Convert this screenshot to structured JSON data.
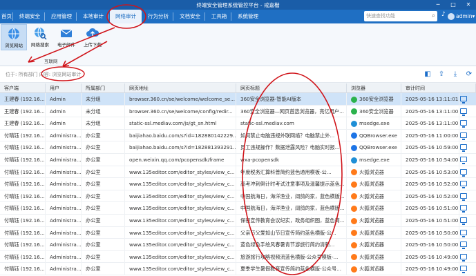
{
  "window": {
    "title": "终端安全管理系统管控平台 - 戒嘉楷",
    "min": "─",
    "max": "□",
    "close": "✕"
  },
  "menu": {
    "items": [
      {
        "label": "首页"
      },
      {
        "label": "终端安全"
      },
      {
        "label": "应用管理"
      },
      {
        "label": "本地审计"
      },
      {
        "label": "网络审计"
      },
      {
        "label": "行为分析"
      },
      {
        "label": "文档安全"
      },
      {
        "label": "工具箱"
      },
      {
        "label": "系统管理"
      }
    ],
    "active": "网络审计"
  },
  "search": {
    "placeholder": "快速查找功能"
  },
  "user": {
    "name": "admin",
    "caret": "▾"
  },
  "toolbar": {
    "tools": [
      {
        "label": "浏览网站",
        "icon": "globe-browse-icon"
      },
      {
        "label": "网络搜索",
        "icon": "globe-search-icon"
      },
      {
        "label": "电子邮件",
        "icon": "email-icon"
      },
      {
        "label": "上传下载",
        "icon": "cloud-upload-icon"
      }
    ],
    "group_label": "互联网"
  },
  "breadcrumb": {
    "text": "位于: 所有部门 内容: 浏览网站审计"
  },
  "table": {
    "columns": [
      "客户端",
      "用户",
      "所属部门",
      "网页地址",
      "网页标题",
      "浏览器",
      "审计时间"
    ],
    "rows": [
      [
        "王建春 (192.16...",
        "Admin",
        "未分组",
        "browser.360.cn/se/welcome/welcome_se...",
        "360安全浏览器-智能AI版本",
        "360安全浏览器",
        "2025-05-16 13:11:01"
      ],
      [
        "王建春 (192.16...",
        "Admin",
        "未分组",
        "browser.360.cn/se/welcome/config/redir...",
        "360安全浏览器—网页首选浏览器，亮亿用户...",
        "360安全浏览器",
        "2025-05-16 13:11:00"
      ],
      [
        "王建春 (192.16...",
        "Admin",
        "未分组",
        "static-ssl.mediav.com/js/gt_sn.html",
        "static-ssl.mediav.com",
        "msedge.exe",
        "2025-05-16 13:11:00"
      ],
      [
        "付晴钰 (192.16...",
        "Administra...",
        "办公室",
        "baijiahao.baidu.com/s?id=182880142229...",
        "如何禁止电脑违规外联网络？电脑禁止外...",
        "QQBrowser.exe",
        "2025-05-16 11:00:00"
      ],
      [
        "付晴钰 (192.16...",
        "Administra...",
        "办公室",
        "baijiahao.baidu.com/s?id=182881393291...",
        "员工违规操作？数据泄露风险？电脑实时报...",
        "QQBrowser.exe",
        "2025-05-16 10:59:00"
      ],
      [
        "付晴钰 (192.16...",
        "Administra...",
        "办公室",
        "open.weixin.qq.com/pcopensdk/frame",
        "wxa-pcopensdk",
        "msedge.exe",
        "2025-05-16 10:54:00"
      ],
      [
        "付晴钰 (192.16...",
        "Administra...",
        "办公室",
        "www.135editor.com/editor_styles/view_c...",
        "年度税务汇算科普简约蓝色通用模板-公...",
        "火狐浏览器",
        "2025-05-16 10:53:00"
      ],
      [
        "付晴钰 (192.16...",
        "Administra...",
        "办公室",
        "www.135editor.com/editor_styles/view_c...",
        "高考冲刺倒计时考试注意事项及温馨提示蓝色...",
        "火狐浏览器",
        "2025-05-16 10:52:00"
      ],
      [
        "付晴钰 (192.16...",
        "Administra...",
        "办公室",
        "www.135editor.com/editor_styles/view_c...",
        "中国航海日，海洋渔业，阔鸽的家，蓝色横版...",
        "火狐浏览器",
        "2025-05-16 10:52:00"
      ],
      [
        "付晴钰 (192.16...",
        "Administra...",
        "办公室",
        "www.135editor.com/editor_styles/view_c...",
        "中国航海日，海洋渔业，阔鸽的家，蓝色横版...",
        "火狐浏览器",
        "2025-05-16 10:51:00"
      ],
      [
        "付晴钰 (192.16...",
        "Administra...",
        "办公室",
        "www.135editor.com/editor_styles/view_c...",
        "保密宣传教育会议纪实，政务组织图，蓝色简...",
        "火狐浏览器",
        "2025-05-16 10:51:00"
      ],
      [
        "付晴钰 (192.16...",
        "Administra...",
        "办公室",
        "www.135editor.com/editor_styles/view_c...",
        "父亲节父爱如山节日宣传简约蓝色横版-公...",
        "火狐浏览器",
        "2025-05-16 10:50:00"
      ],
      [
        "付晴钰 (192.16...",
        "Administra...",
        "办公室",
        "www.135editor.com/editor_styles/view_c...",
        "蓝色绿色手绘风春暑青节游旅行简约清新...",
        "火狐浏览器",
        "2025-05-16 10:50:00"
      ],
      [
        "付晴钰 (192.16...",
        "Administra...",
        "办公室",
        "www.135editor.com/editor_styles/view_c...",
        "旅游旅行攻略视频流蓝色横版-公众号模板-...",
        "火狐浏览器",
        "2025-05-16 10:49:00"
      ],
      [
        "付晴钰 (192.16...",
        "Administra...",
        "办公室",
        "www.135editor.com/editor_styles/view_c...",
        "夏季学生暑假教育宣传简约蓝色横版-公众号...",
        "火狐浏览器",
        "2025-05-16 10:49:00"
      ]
    ],
    "browser_colors": {
      "360安全浏览器": "#2bb24c",
      "msedge.exe": "#1f8fd6",
      "QQBrowser.exe": "#1d74e6",
      "火狐浏览器": "#ff7a1a"
    }
  }
}
